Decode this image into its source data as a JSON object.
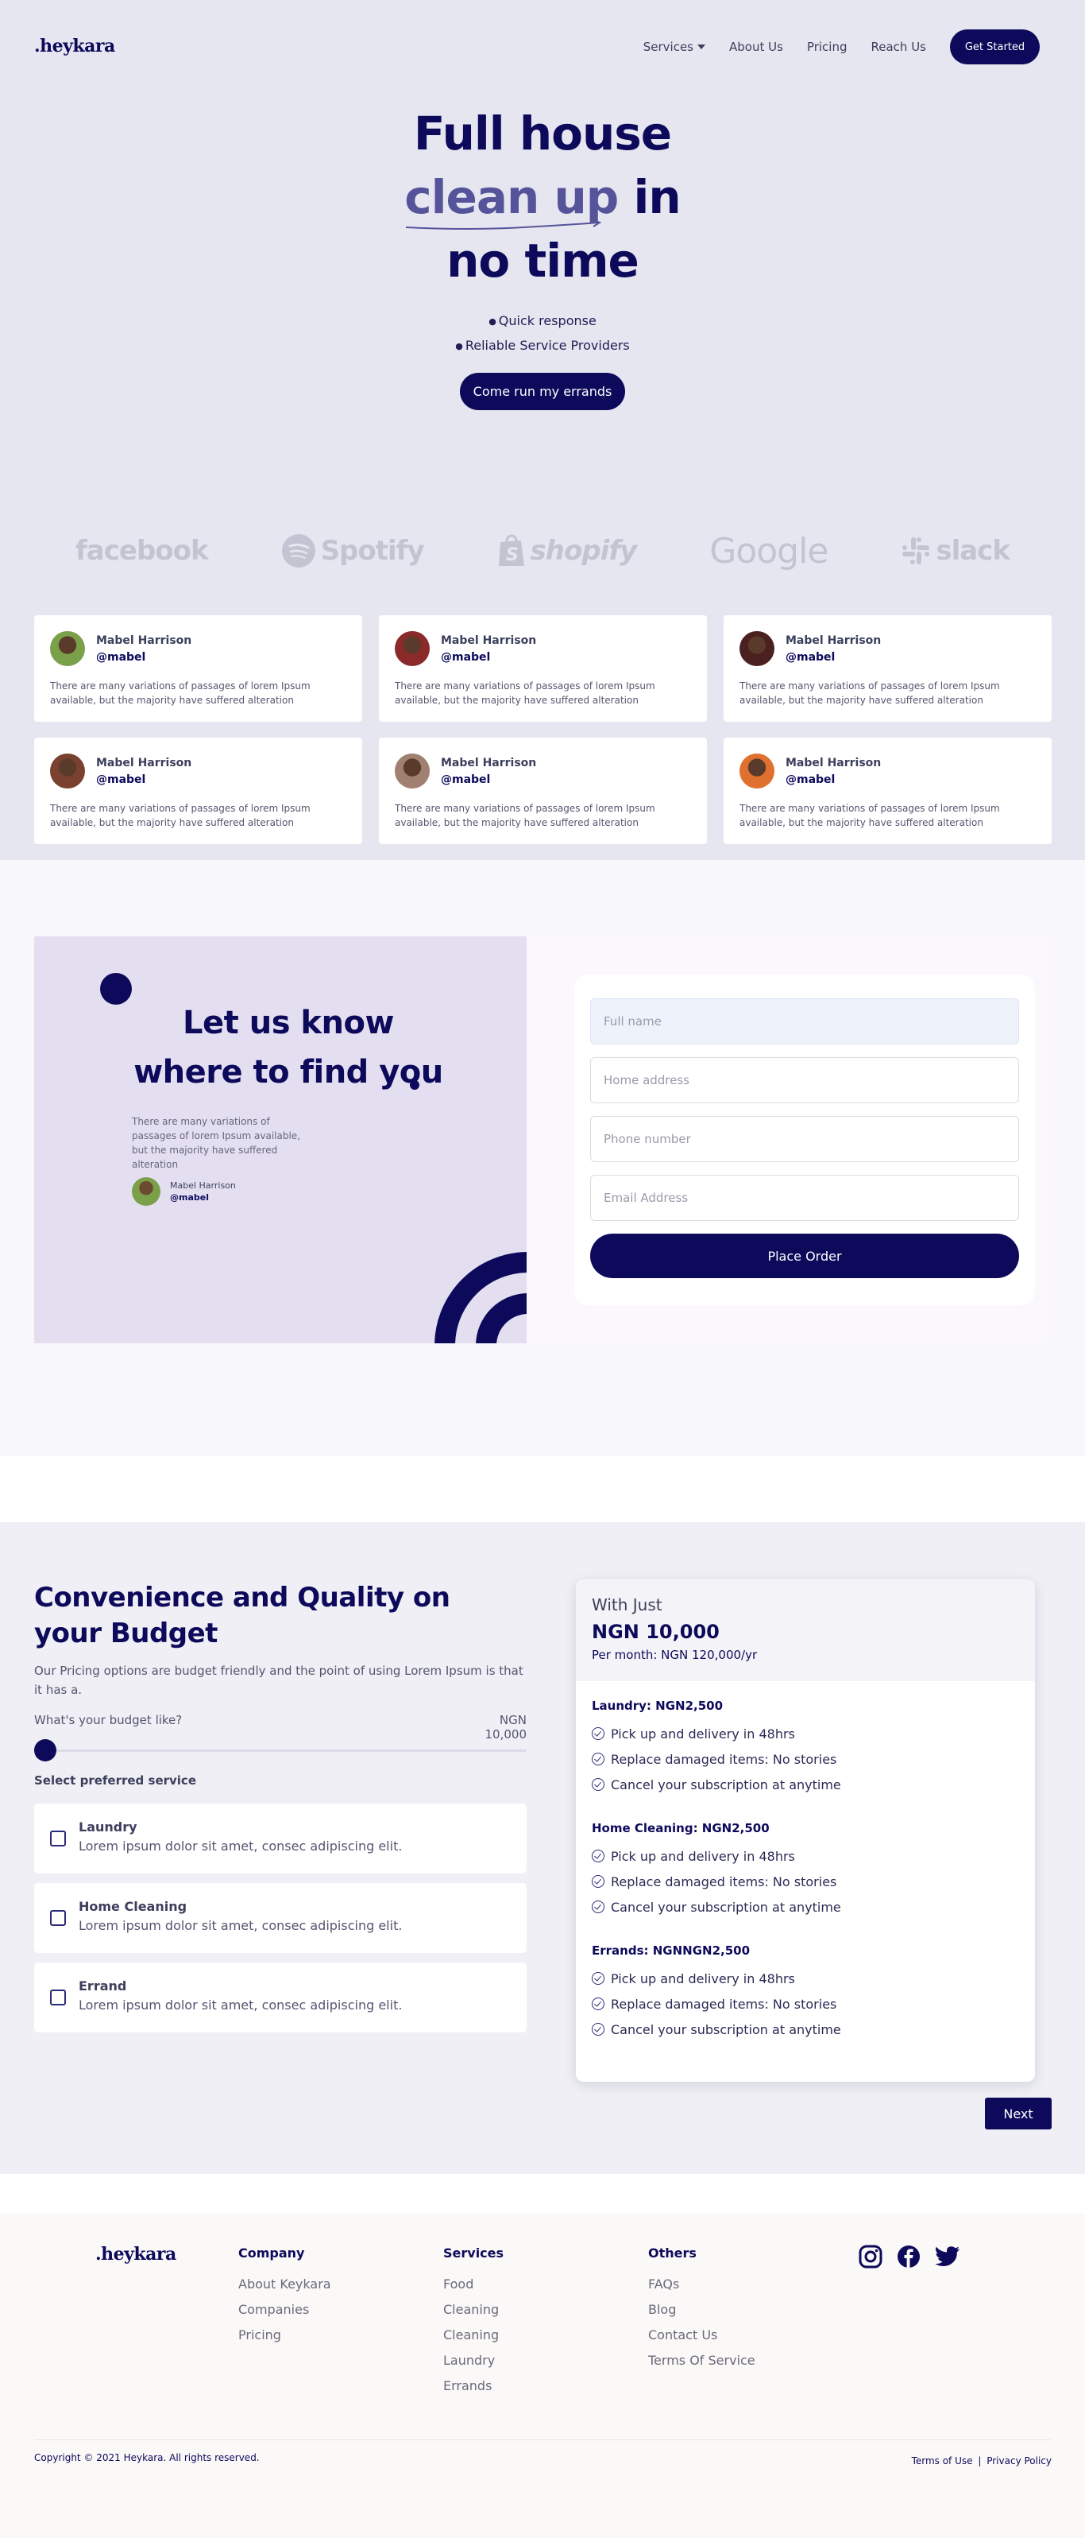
{
  "nav": {
    "logo": ".heykara",
    "links": [
      "Services",
      "About Us",
      "Pricing",
      "Reach Us"
    ],
    "cta": "Get Started"
  },
  "hero": {
    "title_line1": "Full house",
    "title_highlight": "clean up",
    "title_in": " in",
    "title_line3": "no time",
    "bullets": [
      "Quick response",
      "Reliable Service Providers"
    ],
    "cta": "Come run my errands"
  },
  "brands": [
    "facebook",
    "Spotify",
    "shopify",
    "Google",
    "slack"
  ],
  "testimonials": [
    {
      "name": "Mabel Harrison",
      "handle": "@mabel",
      "text": "There are many variations of passages of lorem Ipsum available, but the majority have suffered alteration",
      "avatar_color": "#7aa04a"
    },
    {
      "name": "Mabel Harrison",
      "handle": "@mabel",
      "text": "There are many variations of passages of lorem Ipsum available, but the majority have suffered alteration",
      "avatar_color": "#8a2a2a"
    },
    {
      "name": "Mabel Harrison",
      "handle": "@mabel",
      "text": "There are many variations of passages of lorem Ipsum available, but the majority have suffered alteration",
      "avatar_color": "#4a2020"
    },
    {
      "name": "Mabel Harrison",
      "handle": "@mabel",
      "text": "There are many variations of passages of lorem Ipsum available, but the majority have suffered alteration",
      "avatar_color": "#7a4030"
    },
    {
      "name": "Mabel Harrison",
      "handle": "@mabel",
      "text": "There are many variations of passages of lorem Ipsum available, but the majority have suffered alteration",
      "avatar_color": "#a08070"
    },
    {
      "name": "Mabel Harrison",
      "handle": "@mabel",
      "text": "There are many variations of passages of lorem Ipsum available, but the majority have suffered alteration",
      "avatar_color": "#e07030"
    }
  ],
  "find": {
    "title": "Let us know where to find you",
    "text": "There are many variations of passages of lorem Ipsum available, but the majority have suffered alteration",
    "name": "Mabel Harrison",
    "handle": "@mabel",
    "fields": {
      "full_name": "Full name",
      "address": "Home address",
      "phone": "Phone number",
      "email": "Email Address"
    },
    "submit": "Place Order"
  },
  "pricing": {
    "title": "Convenience and Quality on your Budget",
    "text": "Our Pricing options are budget friendly and the point of using Lorem Ipsum is that it has a.",
    "budget_label": "What's your budget like?",
    "budget_value": "NGN 10,000",
    "budget_fraction": 0.0,
    "select_label": "Select preferred service",
    "services": [
      {
        "name": "Laundry",
        "desc": "Lorem ipsum dolor sit amet, consec adipiscing elit."
      },
      {
        "name": "Home Cleaning",
        "desc": "Lorem ipsum dolor sit amet, consec adipiscing elit."
      },
      {
        "name": "Errand",
        "desc": "Lorem ipsum dolor sit amet, consec adipiscing elit."
      }
    ],
    "plan": {
      "with": "With Just",
      "price": "NGN 10,000",
      "per": "Per month: NGN 120,000/yr",
      "groups": [
        {
          "title": "Laundry: NGN2,500",
          "items": [
            "Pick up and delivery in 48hrs",
            "Replace damaged items: No stories",
            "Cancel your subscription at anytime"
          ]
        },
        {
          "title": "Home Cleaning: NGN2,500",
          "items": [
            "Pick up and delivery in 48hrs",
            "Replace damaged items: No stories",
            "Cancel your subscription at anytime"
          ]
        },
        {
          "title": "Errands: NGNNGN2,500",
          "items": [
            "Pick up and delivery in 48hrs",
            "Replace damaged items: No stories",
            "Cancel your subscription at anytime"
          ]
        }
      ]
    },
    "next": "Next"
  },
  "footer": {
    "logo": ".heykara",
    "columns": [
      {
        "title": "Company",
        "links": [
          "About Keykara",
          "Companies",
          "Pricing"
        ]
      },
      {
        "title": "Services",
        "links": [
          "Food",
          "Cleaning",
          "Cleaning",
          "Laundry",
          "Errands"
        ]
      },
      {
        "title": "Others",
        "links": [
          "FAQs",
          "Blog",
          "Contact Us",
          "Terms Of Service"
        ]
      }
    ],
    "social": [
      "instagram-icon",
      "facebook-icon",
      "twitter-icon"
    ],
    "copyright": "Copyright © 2021 Heykara. All rights reserved.",
    "terms": "Terms of Use",
    "separator": "|",
    "privacy": "Privacy Policy"
  },
  "colors": {
    "navy": "#0d0a5b",
    "hero_bg": "#e6e6f0",
    "highlight": "#55549a"
  }
}
